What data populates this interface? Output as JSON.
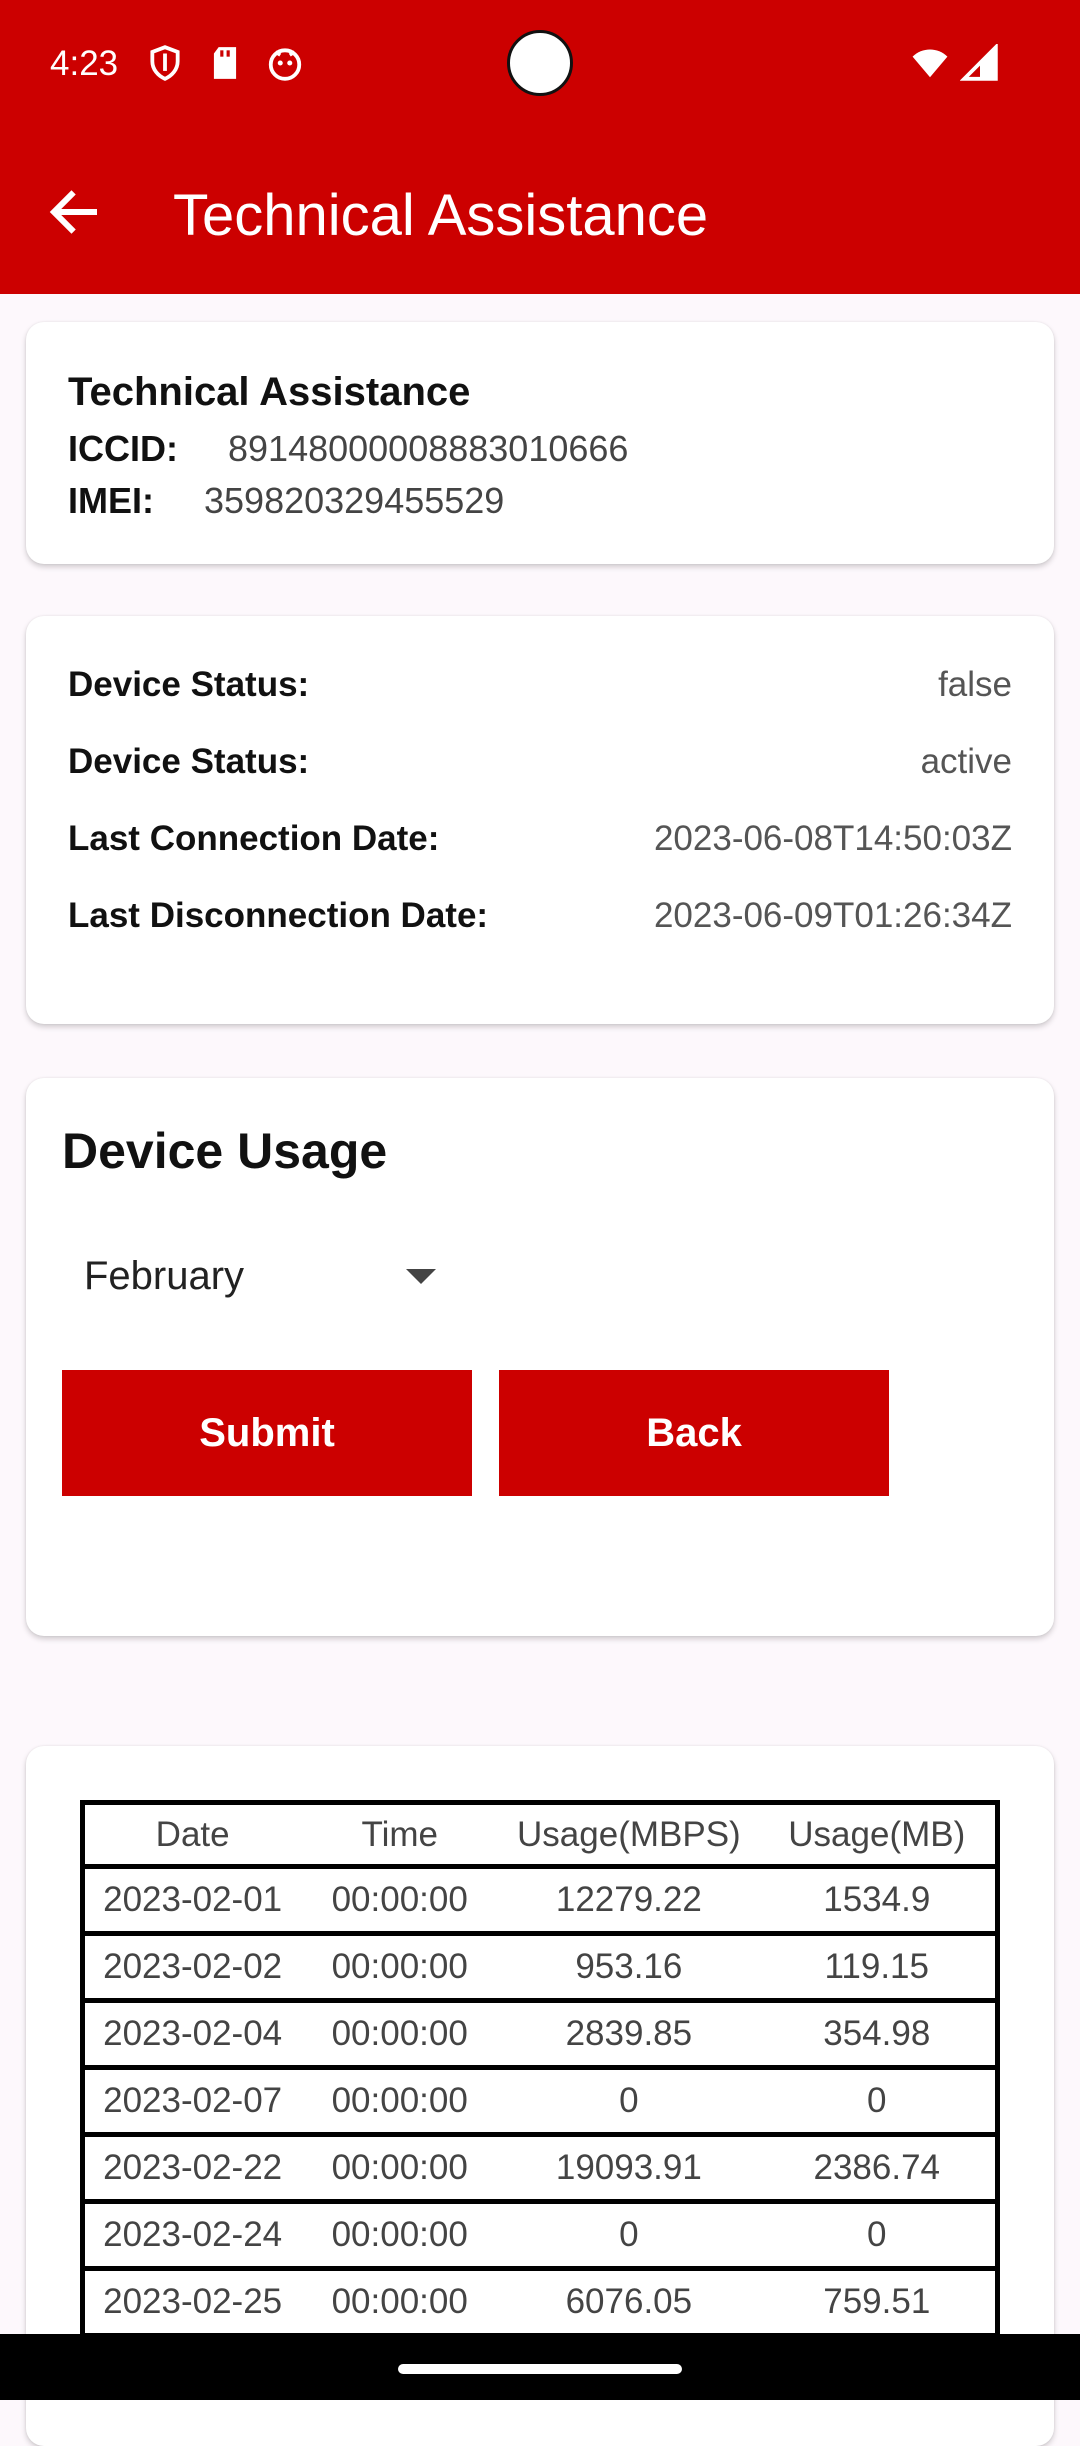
{
  "status_bar": {
    "time": "4:23",
    "left_icons": [
      "shield-icon",
      "sd-card-icon",
      "app-notification-icon"
    ],
    "right_icons": [
      "wifi-icon",
      "cell-signal-icon"
    ]
  },
  "appbar": {
    "back_icon": "arrow-back-icon",
    "title": "Technical Assistance",
    "color": "#cc0000"
  },
  "info_card": {
    "title": "Technical Assistance",
    "iccid_label": "ICCID:",
    "iccid_value": "89148000008883010666",
    "imei_label": "IMEI:",
    "imei_value": "359820329455529"
  },
  "status_card": {
    "rows": [
      {
        "label": "Device Status:",
        "value": "false"
      },
      {
        "label": "Device Status:",
        "value": "active"
      },
      {
        "label": "Last Connection Date:",
        "value": "2023-06-08T14:50:03Z"
      },
      {
        "label": "Last Disconnection Date:",
        "value": "2023-06-09T01:26:34Z"
      }
    ]
  },
  "usage_card": {
    "title": "Device Usage",
    "month_selected": "February",
    "submit_label": "Submit",
    "back_label": "Back"
  },
  "usage_table": {
    "headers": [
      "Date",
      "Time",
      "Usage(MBPS)",
      "Usage(MB)"
    ],
    "rows": [
      [
        "2023-02-01",
        "00:00:00",
        "12279.22",
        "1534.9"
      ],
      [
        "2023-02-02",
        "00:00:00",
        "953.16",
        "119.15"
      ],
      [
        "2023-02-04",
        "00:00:00",
        "2839.85",
        "354.98"
      ],
      [
        "2023-02-07",
        "00:00:00",
        "0",
        "0"
      ],
      [
        "2023-02-22",
        "00:00:00",
        "19093.91",
        "2386.74"
      ],
      [
        "2023-02-24",
        "00:00:00",
        "0",
        "0"
      ],
      [
        "2023-02-25",
        "00:00:00",
        "6076.05",
        "759.51"
      ]
    ]
  }
}
